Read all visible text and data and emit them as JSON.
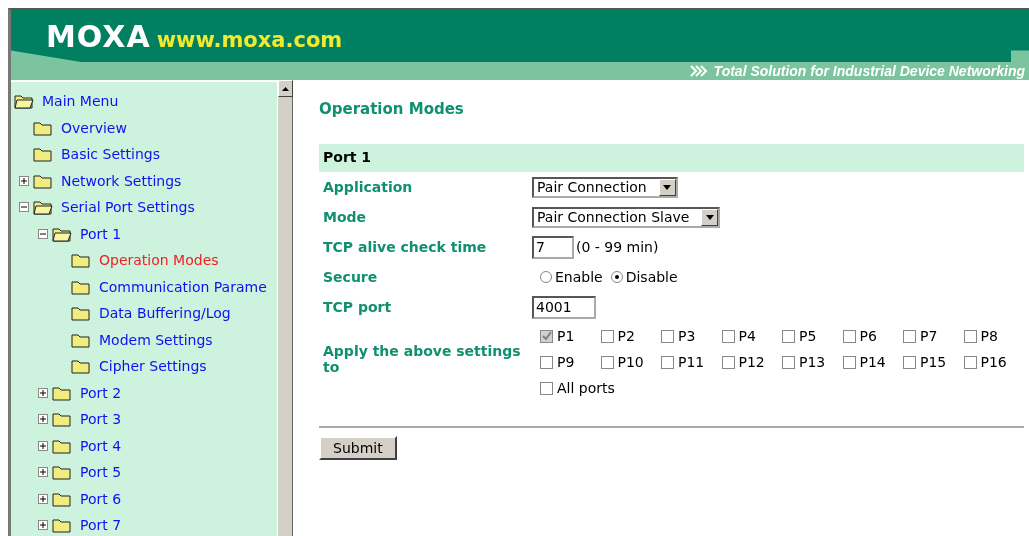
{
  "header": {
    "logo": "MOXA",
    "url": "www.moxa.com",
    "tagline": "Total Solution for Industrial Device Networking"
  },
  "sidebar": {
    "items": [
      {
        "label": "Main Menu",
        "expanded": true,
        "selected": false,
        "children": [
          {
            "label": "Overview",
            "selected": false
          },
          {
            "label": "Basic Settings",
            "selected": false
          },
          {
            "label": "Network Settings",
            "expanded": false,
            "selected": false
          },
          {
            "label": "Serial Port Settings",
            "expanded": true,
            "selected": false,
            "children": [
              {
                "label": "Port 1",
                "expanded": true,
                "selected": false,
                "children": [
                  {
                    "label": "Operation Modes",
                    "selected": true
                  },
                  {
                    "label": "Communication Parame",
                    "selected": false
                  },
                  {
                    "label": "Data Buffering/Log",
                    "selected": false
                  },
                  {
                    "label": "Modem Settings",
                    "selected": false
                  },
                  {
                    "label": "Cipher Settings",
                    "selected": false
                  }
                ]
              },
              {
                "label": "Port 2",
                "expanded": false,
                "selected": false
              },
              {
                "label": "Port 3",
                "expanded": false,
                "selected": false
              },
              {
                "label": "Port 4",
                "expanded": false,
                "selected": false
              },
              {
                "label": "Port 5",
                "expanded": false,
                "selected": false
              },
              {
                "label": "Port 6",
                "expanded": false,
                "selected": false
              },
              {
                "label": "Port 7",
                "expanded": false,
                "selected": false
              }
            ]
          }
        ]
      }
    ]
  },
  "main": {
    "title": "Operation Modes",
    "section": "Port 1",
    "fields": [
      {
        "kind": "select",
        "label": "Application",
        "value": "Pair Connection"
      },
      {
        "kind": "select",
        "label": "Mode",
        "value": "Pair Connection Slave"
      },
      {
        "kind": "text",
        "label": "TCP alive check time",
        "value": "7",
        "hint": "(0 - 99 min)"
      },
      {
        "kind": "radio",
        "label": "Secure",
        "options": [
          {
            "label": "Enable",
            "selected": false
          },
          {
            "label": "Disable",
            "selected": true
          }
        ]
      },
      {
        "kind": "text",
        "label": "TCP port",
        "value": "4001"
      },
      {
        "kind": "ports",
        "label": "Apply the above settings to",
        "ports": [
          {
            "label": "P1",
            "checked": true,
            "disabled": true
          },
          {
            "label": "P2",
            "checked": false,
            "disabled": false
          },
          {
            "label": "P3",
            "checked": false,
            "disabled": false
          },
          {
            "label": "P4",
            "checked": false,
            "disabled": false
          },
          {
            "label": "P5",
            "checked": false,
            "disabled": false
          },
          {
            "label": "P6",
            "checked": false,
            "disabled": false
          },
          {
            "label": "P7",
            "checked": false,
            "disabled": false
          },
          {
            "label": "P8",
            "checked": false,
            "disabled": false
          },
          {
            "label": "P9",
            "checked": false,
            "disabled": false
          },
          {
            "label": "P10",
            "checked": false,
            "disabled": false
          },
          {
            "label": "P11",
            "checked": false,
            "disabled": false
          },
          {
            "label": "P12",
            "checked": false,
            "disabled": false
          },
          {
            "label": "P13",
            "checked": false,
            "disabled": false
          },
          {
            "label": "P14",
            "checked": false,
            "disabled": false
          },
          {
            "label": "P15",
            "checked": false,
            "disabled": false
          },
          {
            "label": "P16",
            "checked": false,
            "disabled": false
          }
        ],
        "all": {
          "label": "All ports",
          "checked": false
        }
      }
    ],
    "submit": "Submit"
  }
}
